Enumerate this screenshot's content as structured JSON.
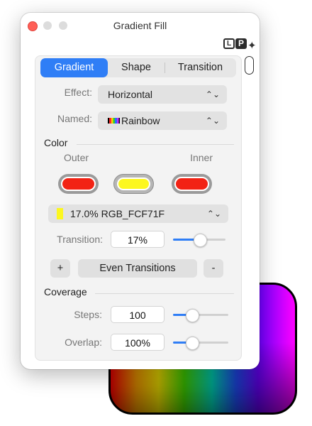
{
  "window": {
    "title": "Gradient Fill"
  },
  "logo_text": "LP",
  "tabs": [
    {
      "label": "Gradient",
      "selected": true
    },
    {
      "label": "Shape",
      "selected": false
    },
    {
      "label": "Transition",
      "selected": false
    }
  ],
  "effect": {
    "label": "Effect:",
    "value": "Horizontal"
  },
  "named": {
    "label": "Named:",
    "value": "Rainbow"
  },
  "color_section": {
    "title": "Color",
    "outer_label": "Outer",
    "inner_label": "Inner",
    "wells": [
      {
        "color": "#f22214",
        "selected": false
      },
      {
        "color": "#fcf71f",
        "selected": true
      },
      {
        "color": "#f22214",
        "selected": false
      }
    ],
    "stop_popup": {
      "value": "17.0% RGB_FCF71F",
      "swatch": "#fcf71f"
    }
  },
  "transition": {
    "label": "Transition:",
    "value": "17%",
    "level": 0.5
  },
  "buttons": {
    "add": "+",
    "even": "Even Transitions",
    "remove": "-"
  },
  "coverage": {
    "title": "Coverage",
    "steps": {
      "label": "Steps:",
      "value": "100",
      "level": 0.33
    },
    "overlap": {
      "label": "Overlap:",
      "value": "100%",
      "level": 0.33
    }
  },
  "colors": {
    "accent": "#2f7ef6",
    "close": "#ff5f57"
  }
}
